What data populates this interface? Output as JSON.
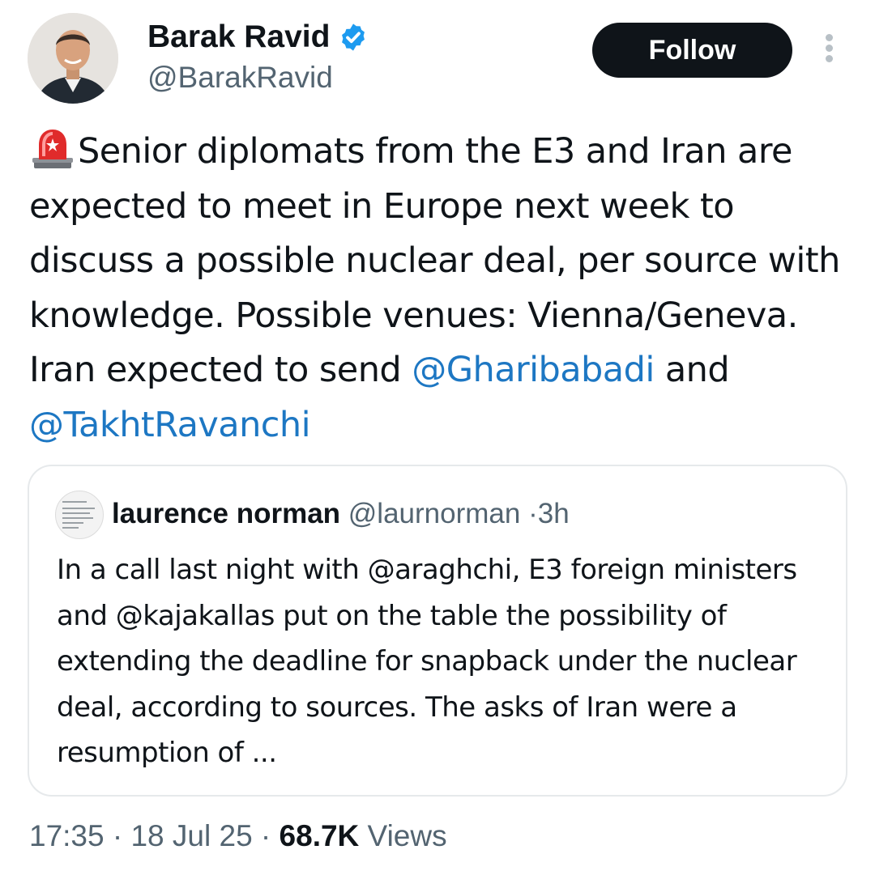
{
  "author": {
    "name": "Barak Ravid",
    "handle": "@BarakRavid",
    "verified": true,
    "follow_label": "Follow"
  },
  "tweet": {
    "emoji": "🚨",
    "segments": [
      {
        "text": "Senior diplomats from the E3 and Iran are expected to meet in Europe next week to discuss a possible nuclear deal, per source with knowledge. Possible venues: Vienna/Geneva. Iran expected to send "
      },
      {
        "text": "@Gharibabadi",
        "mention": true
      },
      {
        "text": " and "
      },
      {
        "text": "@TakhtRavanchi",
        "mention": true
      }
    ]
  },
  "quote": {
    "name": "laurence norman",
    "handle": "@laurnorman",
    "separator": "·",
    "time": "3h",
    "text": "In a call last night with @araghchi, E3 foreign ministers and @kajakallas put on the table the possibility of extending the deadline for snapback under the nuclear deal, according to sources. The asks of Iran were a resumption of ..."
  },
  "footer": {
    "time": "17:35",
    "sep1": " · ",
    "date": "18 Jul 25",
    "sep2": " · ",
    "views_count": "68.7K",
    "views_label": " Views"
  },
  "colors": {
    "mention": "#1d77c3",
    "verified": "#1d9bf0",
    "follow_bg": "#0f1419",
    "secondary_text": "#536471"
  },
  "icons": [
    "verified-badge-icon",
    "more-options-icon",
    "siren-emoji-icon"
  ]
}
